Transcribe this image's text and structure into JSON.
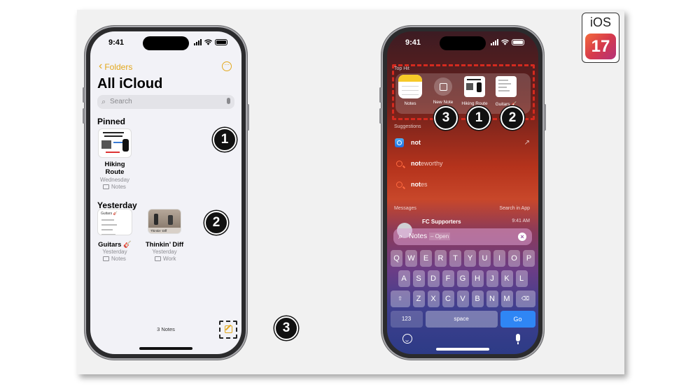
{
  "logo": {
    "os": "iOS",
    "version": "17"
  },
  "left_phone": {
    "status_time": "9:41",
    "back_label": "Folders",
    "more_label": "···",
    "title": "All iCloud",
    "search_placeholder": "Search",
    "pinned_header": "Pinned",
    "pinned_note": {
      "title_line1": "Hiking",
      "title_line2": "Route",
      "date": "Wednesday",
      "folder": "Notes"
    },
    "yesterday_header": "Yesterday",
    "notes": [
      {
        "title": "Guitars 🎸",
        "date": "Yesterday",
        "folder": "Notes",
        "thumb_caption": "Guitars 🎸"
      },
      {
        "title": "Thinkin’ Diff",
        "date": "Yesterday",
        "folder": "Work",
        "thumb_caption": "Thinkin’ Diff"
      }
    ],
    "notes_count": "3 Notes"
  },
  "right_phone": {
    "status_time": "9:41",
    "top_hit_header": "Top Hit",
    "apps": [
      {
        "label": "Notes",
        "icon": "notes-app-icon"
      },
      {
        "label": "New Note",
        "icon": "compose-icon"
      },
      {
        "label": "Hiking Route",
        "icon": "sketch-thumbnail"
      },
      {
        "label": "Guitars 🎸",
        "icon": "document-thumbnail"
      }
    ],
    "suggestions_header": "Suggestions",
    "suggestions": [
      {
        "bold": "not",
        "rest": "",
        "icon": "safari-icon"
      },
      {
        "bold": "not",
        "rest": "eworthy",
        "icon": "search-icon"
      },
      {
        "bold": "not",
        "rest": "es",
        "icon": "search-icon"
      }
    ],
    "messages_header": "Messages",
    "search_in_app": "Search in App",
    "message": {
      "name": "FC Supporters",
      "time": "9:41 AM"
    },
    "search_field": {
      "value": "Notes",
      "hint": "– Open"
    },
    "keyboard": {
      "row1": [
        "Q",
        "W",
        "E",
        "R",
        "T",
        "Y",
        "U",
        "I",
        "O",
        "P"
      ],
      "row2": [
        "A",
        "S",
        "D",
        "F",
        "G",
        "H",
        "J",
        "K",
        "L"
      ],
      "row3": [
        "Z",
        "X",
        "C",
        "V",
        "B",
        "N",
        "M"
      ],
      "numbers_key": "123",
      "space_key": "space",
      "go_key": "Go"
    }
  },
  "callouts": [
    "1",
    "2",
    "3"
  ],
  "colors": {
    "notes_accent": "#e3a81c",
    "highlight_red": "#d42a1f",
    "go_blue": "#2f86f5"
  }
}
